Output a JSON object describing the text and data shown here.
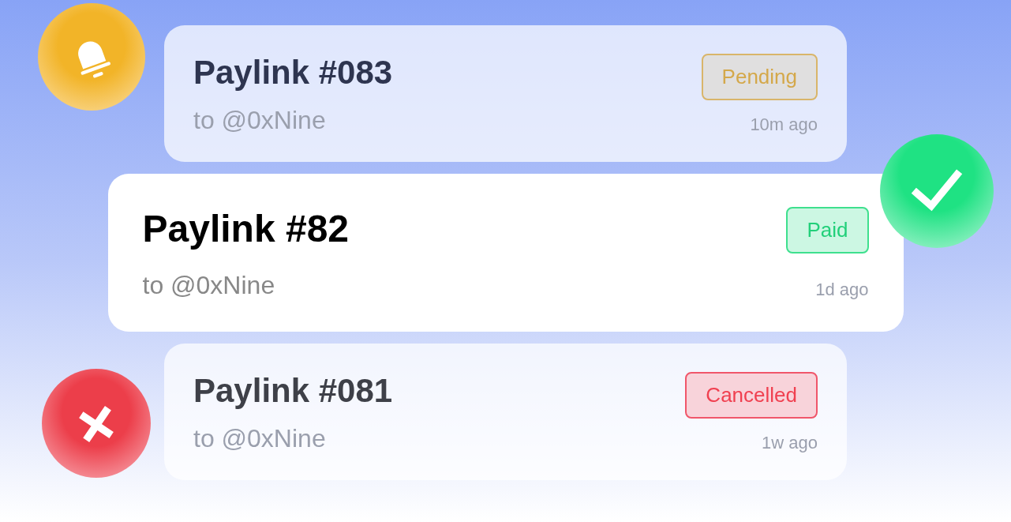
{
  "paylinks": [
    {
      "title": "Paylink #083",
      "recipient": "to @0xNine",
      "status": {
        "kind": "pending",
        "label": "Pending"
      },
      "time": "10m ago",
      "selected": false
    },
    {
      "title": "Paylink #82",
      "recipient": "to @0xNine",
      "status": {
        "kind": "paid",
        "label": "Paid"
      },
      "time": "1d ago",
      "selected": true
    },
    {
      "title": "Paylink #081",
      "recipient": "to @0xNine",
      "status": {
        "kind": "cancelled",
        "label": "Cancelled"
      },
      "time": "1w ago",
      "selected": false
    }
  ]
}
